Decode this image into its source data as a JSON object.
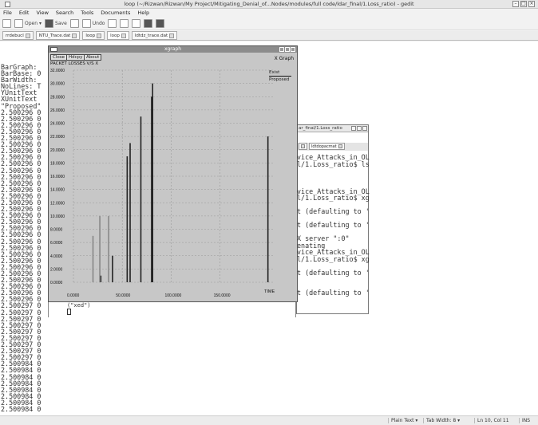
{
  "window": {
    "title": "loop (~/Rizwan/Rizwan/My Project/Mitigating_Denial_of...Nodes/modules/full code/ldar_final/1.Loss_ratio) - gedit"
  },
  "menu": [
    "File",
    "Edit",
    "View",
    "Search",
    "Tools",
    "Documents",
    "Help"
  ],
  "toolbar": {
    "open": "Open",
    "save": "Save",
    "undo": "Undo"
  },
  "tabs": [
    "rrdebucl",
    "NTU_Trace.dat",
    "loop",
    "loop",
    "ldtdz_trace.dat"
  ],
  "editor_lines": [
    "BarGraph:",
    "BarBase: 0",
    "BarWidth:",
    "NoLines: T",
    "YUnitText",
    "XUnitText",
    "\"Proposed\"",
    "2.500296 0",
    "2.500296 0",
    "2.500296 0",
    "2.500296 0",
    "2.500296 0",
    "2.500296 0",
    "2.500296 0",
    "2.500296 0",
    "2.500296 0",
    "2.500296 0",
    "2.500296 0",
    "2.500296 0",
    "2.500296 0",
    "2.500296 0",
    "2.500296 0",
    "2.500296 0",
    "2.500296 0",
    "2.500296 0",
    "2.500296 0",
    "2.500296 0",
    "2.500296 0",
    "2.500296 0",
    "2.500296 0",
    "2.500296 0",
    "2.500296 0",
    "2.500296 0",
    "2.500296 0",
    "2.500296 0",
    "2.500296 0",
    "2.500296 0",
    "2.500297 0",
    "2.500297 0",
    "2.500297 0",
    "2.500297 0",
    "2.500297 0",
    "2.500297 0",
    "2.500297 0",
    "2.500297 0",
    "2.500297 0",
    "2.500984 0",
    "2.500984 0",
    "2.500984 0",
    "2.500984 0",
    "2.500984 0",
    "2.500984 0",
    "2.500984 0",
    "2.500984 0"
  ],
  "xgraph": {
    "window_title": "xgraph",
    "buttons": [
      "Close",
      "Hdcpy",
      "About"
    ],
    "graph_label": "X Graph",
    "plot_title": "PACKET LOSSES V/S X",
    "legend": [
      "Exist",
      "Proposed"
    ],
    "x_axis_label": "TIME",
    "terminal_input": "(\"xed\")"
  },
  "terminal": {
    "title": "ar_final/1.Loss_ratio",
    "tab": "ldtdopacmat",
    "lines": [
      "vice_Attacks_in_OL",
      "l/1.Loss_ratio$ ls",
      "",
      "",
      "",
      "vice_Attacks_in_OL",
      "l/1.Loss_ratio$ xg",
      "",
      "t (defaulting to '",
      "",
      "t (defaulting to '",
      "",
      "X server \":0\"",
      "enating",
      "vice_Attacks_in_OL",
      "l/1.Loss_ratio$ xg",
      "",
      "t (defaulting to '",
      "",
      "",
      "t (defaulting to '"
    ]
  },
  "status": {
    "lang": "Plain Text",
    "tabwidth": "Tab Width: 8",
    "pos": "Ln 10, Col 11",
    "ins": "INS"
  },
  "chart_data": {
    "type": "bar",
    "title": "PACKET LOSSES V/S X",
    "xlabel": "TIME",
    "ylabel": "",
    "xlim": [
      0,
      205
    ],
    "ylim": [
      0,
      32
    ],
    "x_ticks": [
      "0.0000",
      "50.0000",
      "100.0000",
      "150.0000"
    ],
    "y_ticks": [
      "0.0000",
      "2.0000",
      "4.0000",
      "6.0000",
      "8.0000",
      "10.0000",
      "12.0000",
      "14.0000",
      "16.0000",
      "18.0000",
      "20.0000",
      "22.0000",
      "24.0000",
      "26.0000",
      "28.0000",
      "30.0000",
      "32.0000"
    ],
    "series": [
      {
        "name": "Exist",
        "color": "#222222",
        "x": [
          28,
          40,
          55,
          58,
          69,
          80,
          81,
          199
        ],
        "values": [
          1,
          4,
          19,
          21,
          25,
          28,
          30,
          22
        ]
      },
      {
        "name": "Proposed",
        "color": "#888888",
        "x": [
          20,
          27,
          36
        ],
        "values": [
          7,
          10,
          10
        ]
      }
    ]
  }
}
